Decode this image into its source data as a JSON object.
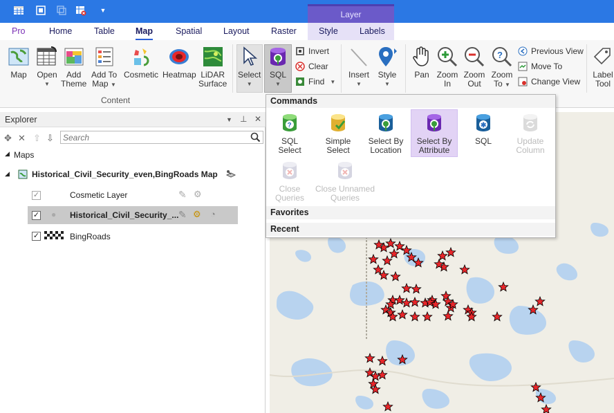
{
  "contextual_tab_group": "Layer",
  "tabs": [
    "Pro",
    "Home",
    "Table",
    "Map",
    "Spatial",
    "Layout",
    "Raster",
    "Style",
    "Labels"
  ],
  "ribbon": {
    "map": "Map",
    "open": "Open",
    "add_theme_1": "Add",
    "add_theme_2": "Theme",
    "add_to_map_1": "Add To",
    "add_to_map_2": "Map",
    "cosmetic": "Cosmetic",
    "heatmap": "Heatmap",
    "lidar_1": "LiDAR",
    "lidar_2": "Surface",
    "content_group": "Content",
    "select": "Select",
    "sql": "SQL",
    "invert": "Invert",
    "clear": "Clear",
    "find": "Find",
    "insert": "Insert",
    "style": "Style",
    "pan": "Pan",
    "zoom_in_1": "Zoom",
    "zoom_in_2": "In",
    "zoom_out_1": "Zoom",
    "zoom_out_2": "Out",
    "zoom_to_1": "Zoom",
    "zoom_to_2": "To",
    "previous_view": "Previous View",
    "move_to": "Move To",
    "change_view": "Change View",
    "label_tool_1": "Label",
    "label_tool_2": "Tool"
  },
  "explorer": {
    "title": "Explorer",
    "search_placeholder": "Search",
    "maps_header": "Maps",
    "map_name": "Historical_Civil_Security_even,BingRoads Map",
    "layers": [
      {
        "name": "Cosmetic Layer",
        "checked": true
      },
      {
        "name": "Historical_Civil_Security_...",
        "checked": true
      },
      {
        "name": "BingRoads",
        "checked": true
      }
    ]
  },
  "dropdown": {
    "commands_header": "Commands",
    "favorites_header": "Favorites",
    "recent_header": "Recent",
    "items": [
      {
        "line1": "SQL",
        "line2": "Select"
      },
      {
        "line1": "Simple",
        "line2": "Select"
      },
      {
        "line1": "Select By",
        "line2": "Location"
      },
      {
        "line1": "Select By",
        "line2": "Attribute"
      },
      {
        "line1": "SQL",
        "line2": ""
      },
      {
        "line1": "Update",
        "line2": "Column"
      },
      {
        "line1": "Close",
        "line2": "Queries"
      },
      {
        "line1": "Close Unnamed",
        "line2": "Queries"
      }
    ]
  },
  "colors": {
    "titlebar": "#2b78e4",
    "contextual": "#6b5ac9",
    "star": "#e8262a",
    "highlight": "#e2d3f5"
  }
}
